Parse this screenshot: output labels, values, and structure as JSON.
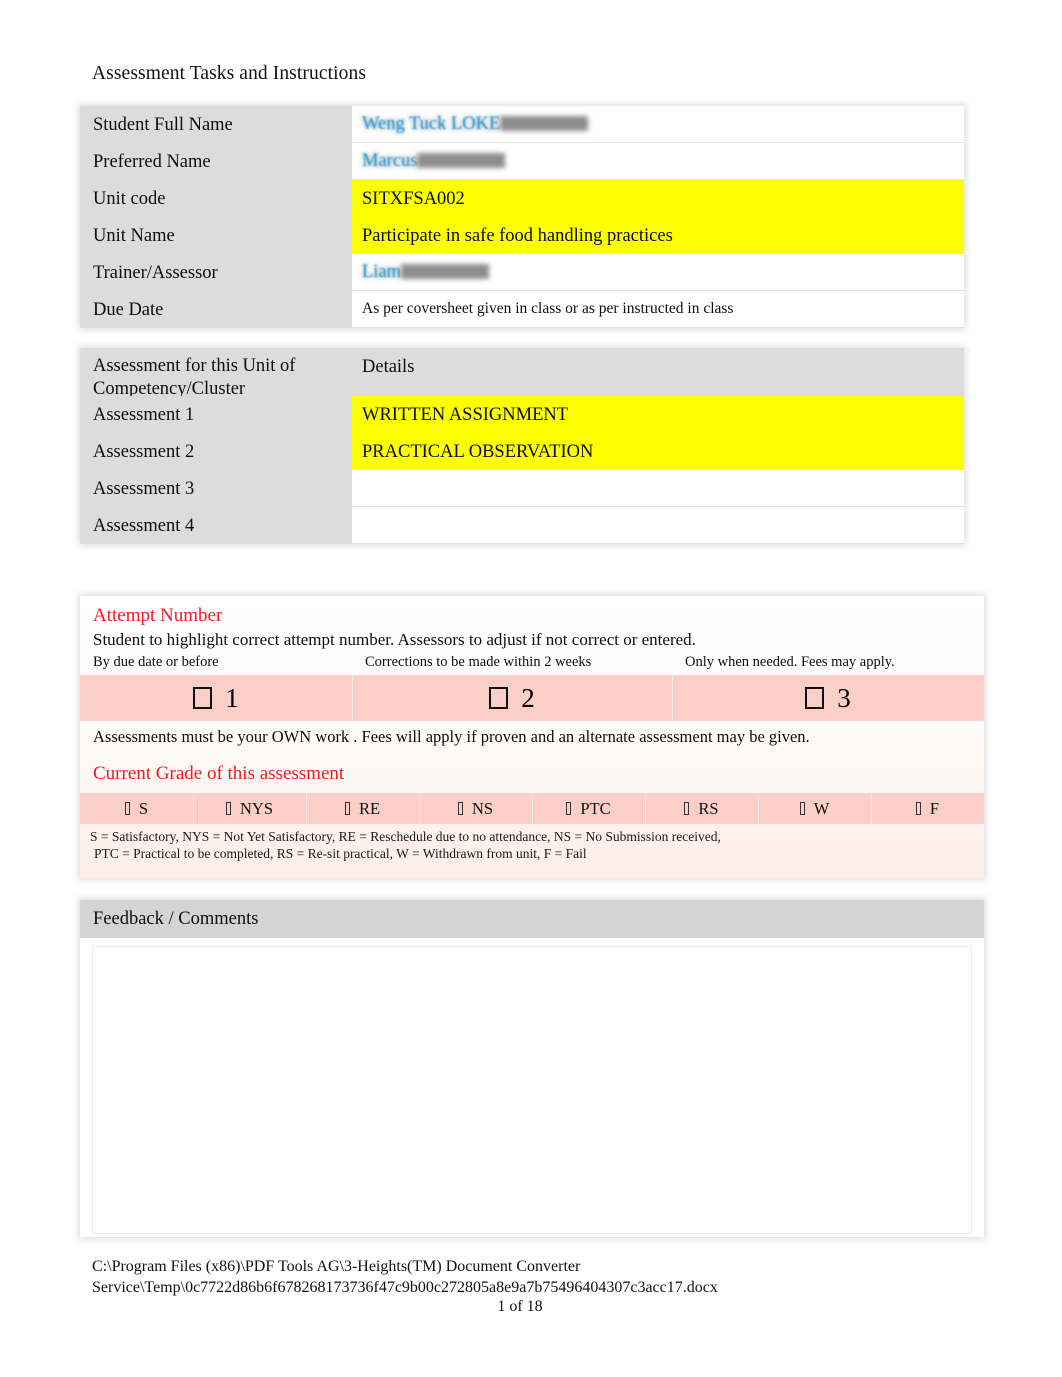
{
  "document": {
    "title": "Assessment Tasks and Instructions"
  },
  "student_table": {
    "rows": [
      {
        "label": "Student Full Name",
        "value": "Weng Tuck LOKE",
        "style": "redacted"
      },
      {
        "label": "Preferred Name",
        "value": "Marcus",
        "style": "redacted"
      },
      {
        "label": "Unit code",
        "value": "SITXFSA002",
        "style": "highlight"
      },
      {
        "label": "Unit Name",
        "value": "Participate in safe food handling practices",
        "style": "highlight"
      },
      {
        "label": "Trainer/Assessor",
        "value": "Liam",
        "style": "redacted"
      },
      {
        "label": "Due Date",
        "value": "As per coversheet given in class or as per instructed in class",
        "style": "small"
      }
    ]
  },
  "assessment_table": {
    "header": {
      "label": "Assessment for this Unit of Competency/Cluster",
      "label_line1": "Assessment for this Unit of",
      "label_line2": "Competency/Cluster",
      "value": "Details"
    },
    "rows": [
      {
        "label": "Assessment 1",
        "value": "WRITTEN ASSIGNMENT",
        "style": "highlight"
      },
      {
        "label": "Assessment 2",
        "value": "PRACTICAL OBSERVATION",
        "style": "highlight"
      },
      {
        "label": "Assessment 3",
        "value": "",
        "style": "plain"
      },
      {
        "label": "Assessment 4",
        "value": "",
        "style": "plain"
      }
    ]
  },
  "attempt": {
    "title": "Attempt Number",
    "subtitle": "Student to highlight correct attempt number. Assessors to adjust if not correct or entered.",
    "notes": [
      "By due date or before",
      "Corrections to be made within 2 weeks",
      "Only when needed. Fees may apply."
    ],
    "options": [
      "1",
      "2",
      "3"
    ],
    "footnote": "Assessments must be your OWN work . Fees will apply if proven and an alternate assessment may be given."
  },
  "grade": {
    "title": "Current Grade of this assessment",
    "options": [
      "S",
      "NYS",
      "RE",
      "NS",
      "PTC",
      "RS",
      "W",
      "F"
    ],
    "legend_line1": "S = Satisfactory, NYS = Not Yet Satisfactory, RE = Reschedule due to no attendance, NS = No Submission received,",
    "legend_line2": "PTC = Practical to be completed, RS = Re-sit practical, W = Withdrawn from unit, F = Fail"
  },
  "feedback": {
    "heading": "Feedback / Comments",
    "body": ""
  },
  "footer": {
    "path_line1": "C:\\Program Files (x86)\\PDF Tools AG\\3-Heights(TM) Document Converter",
    "path_line2": "Service\\Temp\\0c7722d86b6f678268173736f47c9b00c272805a8e9a7b75496404307c3acc17.docx",
    "page": "1 of 18"
  },
  "colors": {
    "highlight_yellow": "#fbff00",
    "accent_red": "#ec1c24",
    "redaction_blue": "#1b9ee0",
    "label_gray": "#dcdcdc",
    "band_pink": "#fbcfc7"
  }
}
